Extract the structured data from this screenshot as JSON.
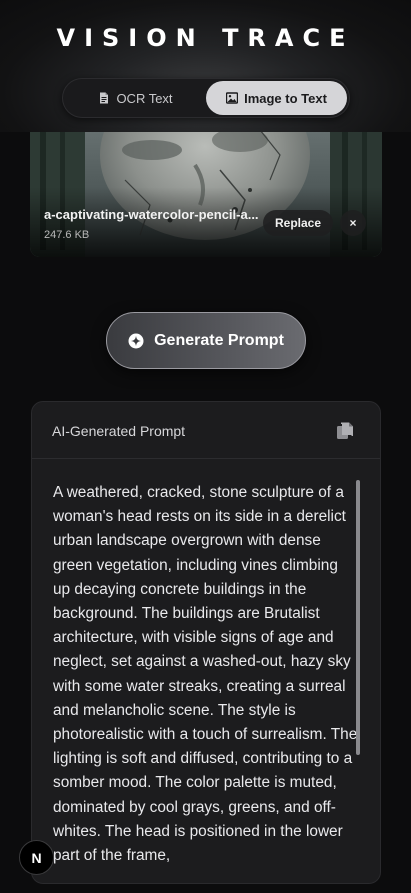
{
  "header": {
    "logo_text": "VISION TRACE",
    "tabs": [
      {
        "label": "OCR Text",
        "icon": "document-icon",
        "active": false
      },
      {
        "label": "Image to Text",
        "icon": "image-icon",
        "active": true
      }
    ]
  },
  "preview": {
    "file_name": "a-captivating-watercolor-pencil-a...",
    "file_size": "247.6 KB",
    "replace_label": "Replace",
    "close_label": "×"
  },
  "generate": {
    "label": "Generate Prompt",
    "icon": "sparkle-icon"
  },
  "prompt": {
    "title": "AI-Generated Prompt",
    "copy_icon": "copy-icon",
    "text": "A weathered, cracked, stone sculpture of a woman's head rests on its side in a derelict urban landscape overgrown with dense green vegetation, including vines climbing up decaying concrete buildings in the background. The buildings are Brutalist architecture, with visible signs of age and neglect, set against a washed-out, hazy sky with some water streaks, creating a surreal and melancholic scene. The style is photorealistic with a touch of surrealism. The lighting is soft and diffused, contributing to a somber mood. The color palette is muted, dominated by cool grays, greens, and off-whites. The head is positioned in the lower part of the frame,"
  },
  "badge": {
    "label": "N"
  }
}
